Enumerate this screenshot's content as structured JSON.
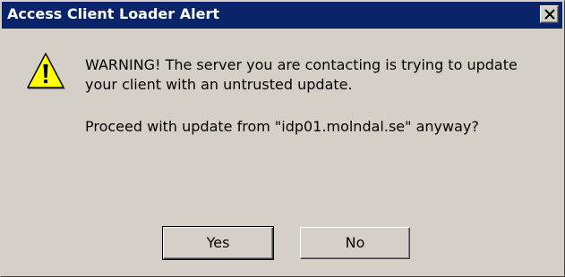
{
  "window": {
    "title": "Access Client Loader Alert",
    "close_icon": "close-x-icon"
  },
  "dialog": {
    "icon": "warning-triangle-icon",
    "message_line1": "WARNING! The server you are contacting is trying to update",
    "message_line2": "your client with an untrusted update.",
    "question": "Proceed with update from \"idp01.molndal.se\" anyway?"
  },
  "buttons": {
    "yes_label": "Yes",
    "no_label": "No"
  },
  "colors": {
    "titlebar": "#0a246a",
    "face": "#d4d0c8",
    "warning_fill": "#ffff00"
  }
}
